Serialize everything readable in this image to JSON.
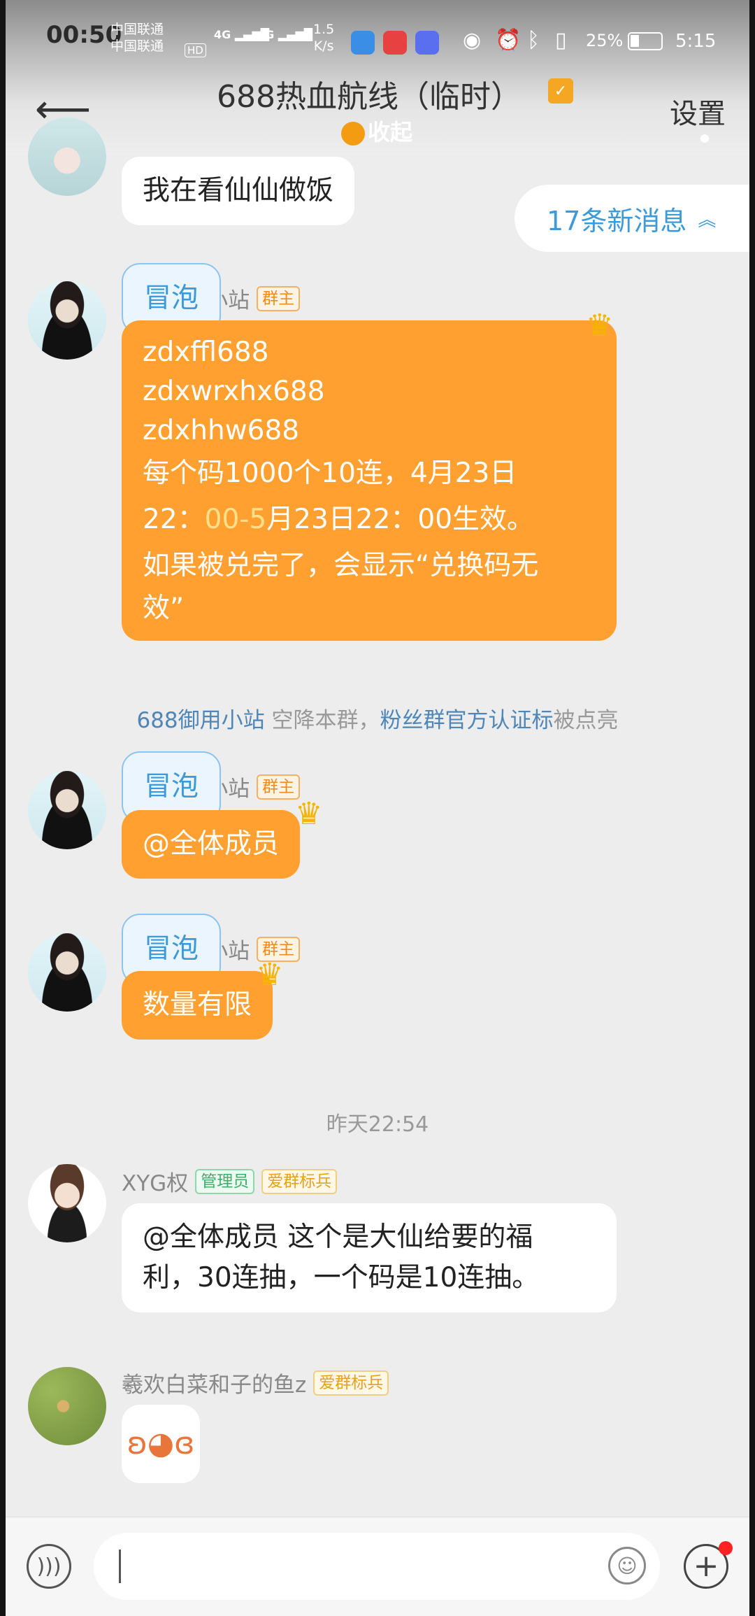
{
  "status_bar": {
    "time": "00:50",
    "carrier_1": "中国联通",
    "carrier_2": "中国联通",
    "hd": "HD",
    "net_1": "4G",
    "net_2": "4G",
    "speed_value": "1.5",
    "speed_unit": "K/s",
    "battery": "25%",
    "clock": "5:15"
  },
  "header": {
    "back_icon": "back-arrow-icon",
    "title": "688热血航线（临时）",
    "subtitle": "收起",
    "settings_label": "设置"
  },
  "new_messages_label": "17条新消息",
  "messages": {
    "m0": {
      "text": "我在看仙仙做饭"
    },
    "m1": {
      "name": "688御用小站",
      "tag_owner": "群主",
      "tag_bubble": "冒泡",
      "line1": "zdxffl688",
      "line2": "zdxwrxhx688",
      "line3": "zdxhhw688",
      "line4": "每个码1000个10连，4月23日",
      "line5a": "22：",
      "line5b": "00-5",
      "line5c": "月23日22：00生效。",
      "line6": "如果被兑完了，会显示“兑换码无",
      "line7": "效”"
    },
    "system": {
      "name": "688御用小站",
      "mid": " 空降本群，",
      "badge": "粉丝群官方认证标",
      "tail": "被点亮"
    },
    "m2": {
      "name": "688御用小站",
      "tag_owner": "群主",
      "tag_bubble": "冒泡",
      "text": "@全体成员"
    },
    "m3": {
      "name": "688御用小站",
      "tag_owner": "群主",
      "tag_bubble": "冒泡",
      "text": "数量有限"
    },
    "timestamp": "昨天22:54",
    "m4": {
      "name": "XYG权",
      "tag_admin": "管理员",
      "tag_soldier": "爱群标兵",
      "line1": "@全体成员 这个是大仙给要的福",
      "line2": "利，30连抽，一个码是10连抽。"
    },
    "m5": {
      "name": "羲欢白菜和子的鱼z",
      "tag_soldier": "爱群标兵",
      "sticker": "sticker-emoji"
    }
  },
  "input": {
    "placeholder": ""
  },
  "colors": {
    "accent_orange": "#ffa030",
    "link_blue": "#4f86b8",
    "badge_red": "#ff2222"
  }
}
